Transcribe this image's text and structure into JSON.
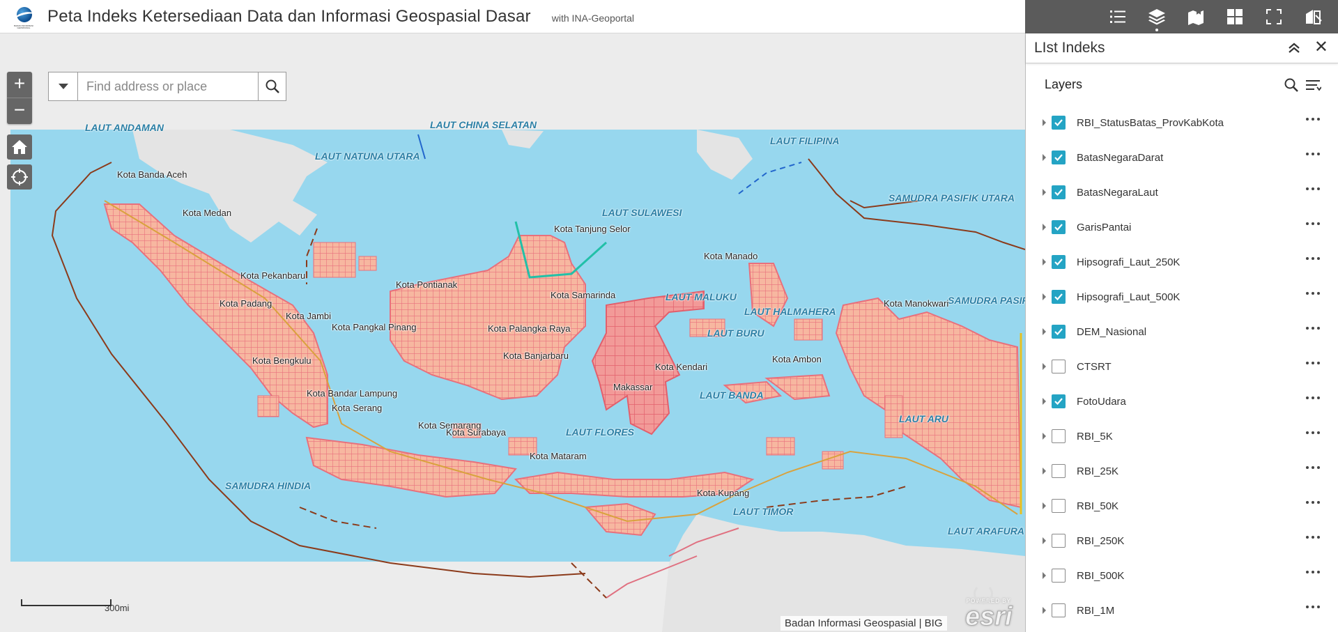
{
  "header": {
    "title": "Peta Indeks Ketersediaan Data dan Informasi Geospasial Dasar",
    "subtitle": "with INA-Geoportal",
    "logo_text": "BADAN INFORMASI GEOSPASIAL"
  },
  "toolbar": {
    "icons": [
      "list-icon",
      "layers-icon",
      "bookmark-map-icon",
      "basemap-gallery-icon",
      "fullscreen-icon",
      "print-icon"
    ]
  },
  "search": {
    "placeholder": "Find address or place"
  },
  "map": {
    "ocean_labels": [
      "LAUT ANDAMAN",
      "LAUT CHINA SELATAN",
      "LAUT NATUNA UTARA",
      "LAUT FILIPINA",
      "SAMUDRA PASIFIK UTARA",
      "LAUT SULAWESI",
      "LAUT MALUKU",
      "LAUT HALMAHERA",
      "LAUT BURU",
      "LAUT BANDA",
      "LAUT FLORES",
      "SAMUDRA HINDIA",
      "LAUT TIMOR",
      "LAUT ARU",
      "LAUT ARAFURA",
      "SAMUDRA PASIFIK SELATAN"
    ],
    "city_labels": [
      "Kota Banda Aceh",
      "Kota Medan",
      "Kota Pekanbaru",
      "Kota Padang",
      "Kota Jambi",
      "Kota Pangkal Pinang",
      "Kota Bengkulu",
      "Kota Bandar Lampung",
      "Kota Serang",
      "Kota Semarang",
      "Kota Surabaya",
      "Kota Mataram",
      "Kota Pontianak",
      "Kota Samarinda",
      "Kota Palangka Raya",
      "Kota Banjarbaru",
      "Kota Tanjung Selor",
      "Kota Manado",
      "Kota Kendari",
      "Makassar",
      "Kota Ambon",
      "Kota Kupang",
      "Kota Manokwari"
    ],
    "scale_label": "300mi",
    "attribution": "Badan Informasi Geospasial | BIG",
    "esri_powered": "POWERED BY",
    "esri_brand": "esri"
  },
  "panel": {
    "title": "LIst Indeks",
    "layers_title": "Layers",
    "layers": [
      {
        "name": "RBI_StatusBatas_ProvKabKota",
        "checked": true
      },
      {
        "name": "BatasNegaraDarat",
        "checked": true
      },
      {
        "name": "BatasNegaraLaut",
        "checked": true
      },
      {
        "name": "GarisPantai",
        "checked": true
      },
      {
        "name": "Hipsografi_Laut_250K",
        "checked": true
      },
      {
        "name": "Hipsografi_Laut_500K",
        "checked": true
      },
      {
        "name": "DEM_Nasional",
        "checked": true
      },
      {
        "name": "CTSRT",
        "checked": false
      },
      {
        "name": "FotoUdara",
        "checked": true
      },
      {
        "name": "RBI_5K",
        "checked": false
      },
      {
        "name": "RBI_25K",
        "checked": false
      },
      {
        "name": "RBI_50K",
        "checked": false
      },
      {
        "name": "RBI_250K",
        "checked": false
      },
      {
        "name": "RBI_500K",
        "checked": false
      },
      {
        "name": "RBI_1M",
        "checked": false
      }
    ]
  },
  "colors": {
    "ocean": "#97d7ee",
    "land": "#e4e4e4",
    "index_fill": "#f5a59a",
    "index_stroke": "#e8707c",
    "toolbar": "#5b5b5b",
    "checkbox": "#24a4c4",
    "boundary": "#8b3a1a"
  }
}
